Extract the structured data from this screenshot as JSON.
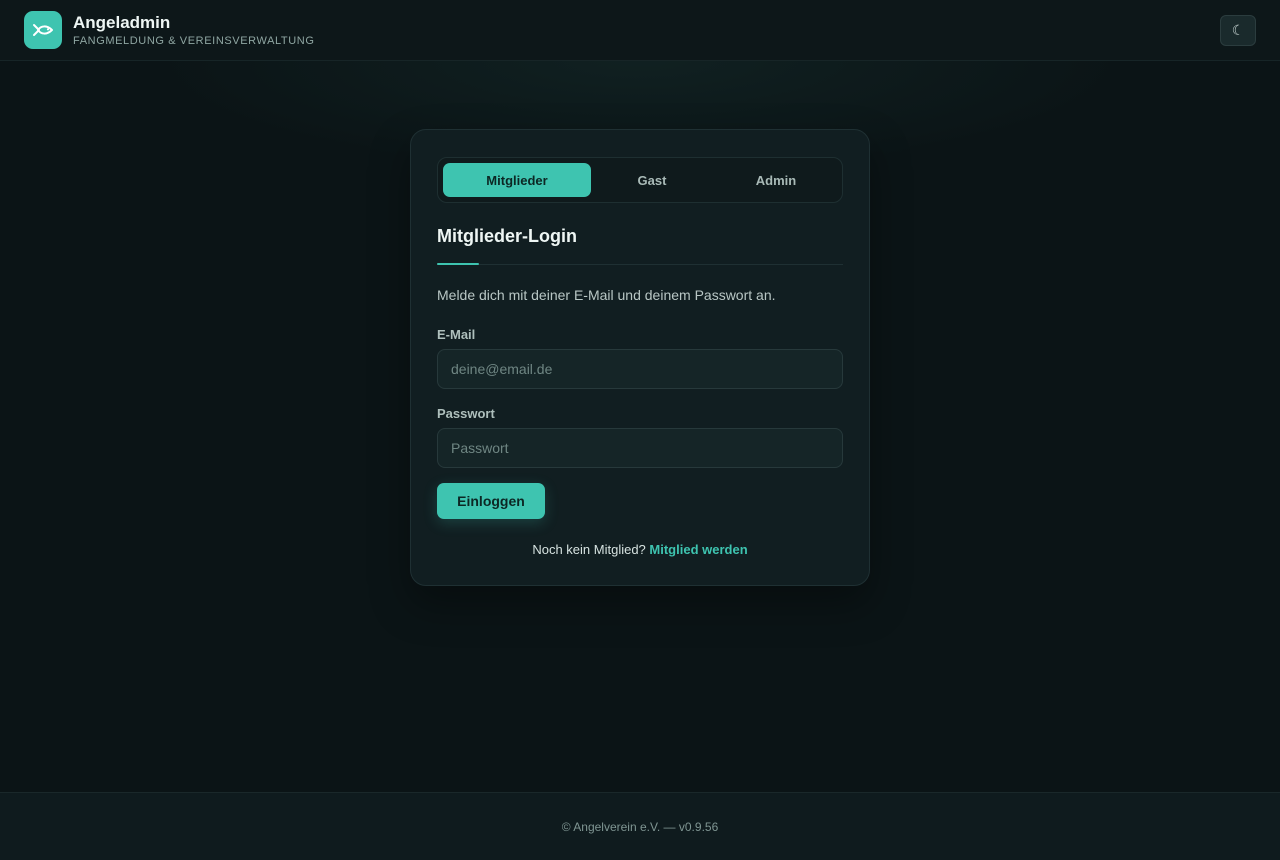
{
  "header": {
    "title": "Angeladmin",
    "subtitle": "FANGMELDUNG & VEREINSVERWALTUNG",
    "logo_icon": "fish-icon",
    "theme_toggle_icon": "☾"
  },
  "login_card": {
    "tabs": [
      {
        "label": "Mitglieder",
        "active": true
      },
      {
        "label": "Gast",
        "active": false
      },
      {
        "label": "Admin",
        "active": false
      }
    ],
    "title": "Mitglieder-Login",
    "intro": "Melde dich mit deiner E-Mail und deinem Passwort an.",
    "email": {
      "label": "E-Mail",
      "value": "",
      "placeholder": "deine@email.de"
    },
    "password": {
      "label": "Passwort",
      "value": "",
      "placeholder": "Passwort"
    },
    "submit_label": "Einloggen",
    "signup_prompt": "Noch kein Mitglied?",
    "signup_link": "Mitglied werden"
  },
  "footer": {
    "text": "© Angelverein e.V. — v0.9.56"
  },
  "colors": {
    "accent": "#3ec4b0",
    "background": "#0b1416",
    "card": "#111e21"
  }
}
